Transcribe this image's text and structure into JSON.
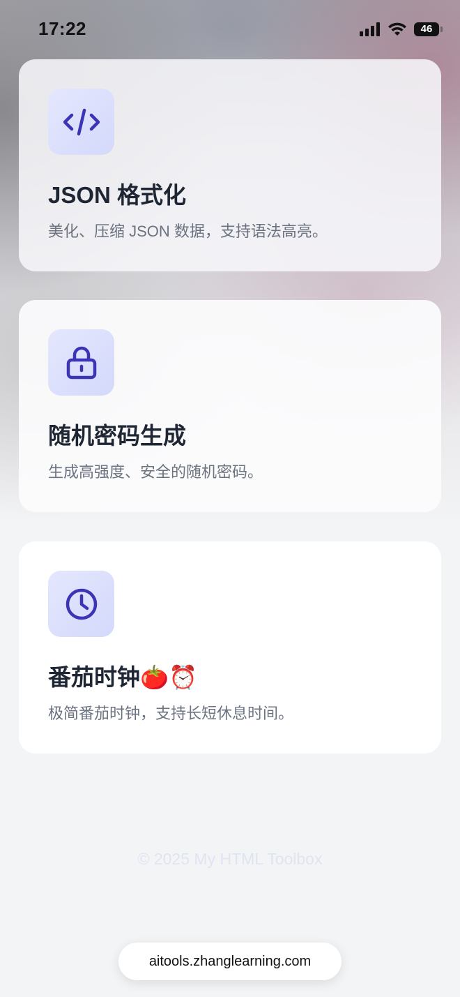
{
  "status_bar": {
    "time": "17:22",
    "battery": "46"
  },
  "tools": [
    {
      "icon": "code-icon",
      "title": "JSON 格式化",
      "description": "美化、压缩 JSON 数据，支持语法高亮。"
    },
    {
      "icon": "lock-icon",
      "title": "随机密码生成",
      "description": "生成高强度、安全的随机密码。"
    },
    {
      "icon": "clock-icon",
      "title": "番茄时钟🍅⏰",
      "description": "极简番茄时钟，支持长短休息时间。"
    }
  ],
  "footer": {
    "copyright": "© 2025 My HTML Toolbox"
  },
  "browser": {
    "url": "aitools.zhanglearning.com"
  },
  "colors": {
    "accent": "#3b35b5",
    "icon_bg": "#dde1fc",
    "title": "#1f2633",
    "description": "#6b7280"
  }
}
